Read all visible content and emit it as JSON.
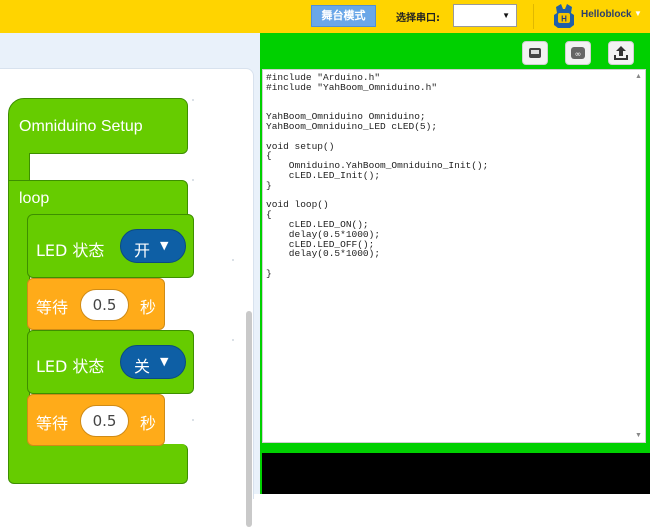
{
  "topbar": {
    "stage_mode": "舞台模式",
    "port_label": "选择串口:",
    "port_value": "",
    "user_name": "Helloblock"
  },
  "blocks": {
    "setup_label": "Omniduino Setup",
    "loop_label": "loop",
    "led1": {
      "label": "LED 状态",
      "value": "开"
    },
    "wait1": {
      "label": "等待",
      "value": "0.5",
      "unit": "秒"
    },
    "led2": {
      "label": "LED 状态",
      "value": "关"
    },
    "wait2": {
      "label": "等待",
      "value": "0.5",
      "unit": "秒"
    }
  },
  "code": {
    "text": "#include \"Arduino.h\"\n#include \"YahBoom_Omniduino.h\"\n\n\nYahBoom_Omniduino Omniduino;\nYahBoom_Omniduino_LED cLED(5);\n\nvoid setup()\n{\n    Omniduino.YahBoom_Omniduino_Init();\n    cLED.LED_Init();\n}\n\nvoid loop()\n{\n    cLED.LED_ON();\n    delay(0.5*1000);\n    cLED.LED_OFF();\n    delay(0.5*1000);\n\n}"
  },
  "colors": {
    "topbar": "#ffd400",
    "code_header": "#00d000",
    "event_block": "#66cc00",
    "control_block": "#ffab19",
    "dropdown": "#0e5fa5"
  },
  "icons": {
    "toolbar": [
      "device-icon",
      "arduino-icon",
      "upload-icon"
    ]
  }
}
